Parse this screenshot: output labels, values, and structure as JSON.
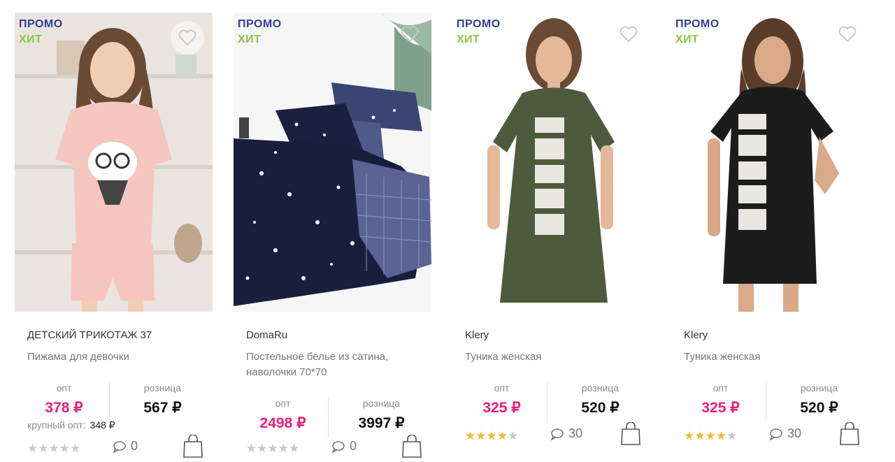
{
  "labels": {
    "promo": "ПРОМО",
    "hit": "ХИТ",
    "opt": "опт",
    "retail": "розница",
    "bulk_opt": "крупный опт:"
  },
  "products": [
    {
      "brand": "ДЕТСКИЙ ТРИКОТАЖ 37",
      "title": "Пижама для девочки",
      "price_opt": "378 ₽",
      "price_retail": "567 ₽",
      "bulk_price": "348 ₽",
      "rating": 0,
      "comments": "0"
    },
    {
      "brand": "DomaRu",
      "title": "Постельное белье из сатина, наволочки 70*70",
      "price_opt": "2498 ₽",
      "price_retail": "3997 ₽",
      "rating": 0,
      "comments": "0"
    },
    {
      "brand": "Klery",
      "title": "Туника женская",
      "price_opt": "325 ₽",
      "price_retail": "520 ₽",
      "rating": 4,
      "comments": "30"
    },
    {
      "brand": "Klery",
      "title": "Туника женская",
      "price_opt": "325 ₽",
      "price_retail": "520 ₽",
      "rating": 4,
      "comments": "30"
    }
  ],
  "colors": {
    "promo": "#2f3e9e",
    "hit": "#8cc63f",
    "opt_price": "#e91e7a",
    "star_on": "#f6b935",
    "star_off": "#c9c9c9"
  },
  "icons": [
    "heart-icon",
    "comment-icon",
    "shopping-bag-icon",
    "star-icon"
  ]
}
